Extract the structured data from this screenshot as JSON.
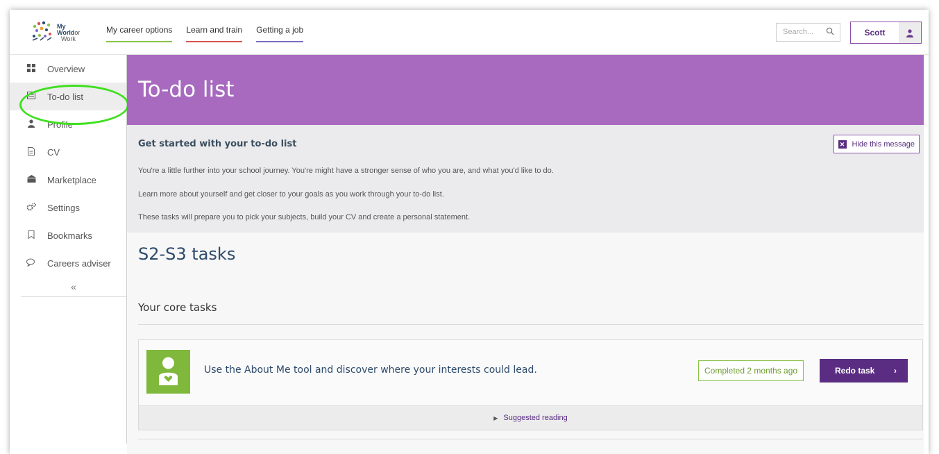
{
  "brand": {
    "logo_line1": "My",
    "logo_line2": "World",
    "logo_or": "or",
    "logo_line3": "Work"
  },
  "nav": [
    {
      "label": "My career options",
      "color": "#89c34a"
    },
    {
      "label": "Learn and train",
      "color": "#d9534f"
    },
    {
      "label": "Getting a job",
      "color": "#7b6cc0"
    }
  ],
  "search": {
    "placeholder": "Search..."
  },
  "user": {
    "name": "Scott"
  },
  "sidebar": {
    "items": [
      {
        "label": "Overview",
        "icon": "grid-icon"
      },
      {
        "label": "To-do list",
        "icon": "list-icon",
        "active": true
      },
      {
        "label": "Profile",
        "icon": "person-icon"
      },
      {
        "label": "CV",
        "icon": "document-icon"
      },
      {
        "label": "Marketplace",
        "icon": "building-icon"
      },
      {
        "label": "Settings",
        "icon": "gear-icon"
      },
      {
        "label": "Bookmarks",
        "icon": "bookmark-icon"
      },
      {
        "label": "Careers adviser",
        "icon": "chat-icon"
      }
    ],
    "collapse_label": "«"
  },
  "page": {
    "title": "To-do list",
    "notice": {
      "title": "Get started with your to-do list",
      "hide_label": "Hide this message",
      "lines": [
        "You're a little further into your school journey. You're might have a stronger sense of who you are, and what you'd like to do.",
        "Learn more about yourself and get closer to your goals as you work through your to-do list.",
        "These tasks will prepare you to pick your subjects, build your CV and create a personal statement."
      ]
    },
    "section_title": "S2-S3 tasks",
    "core_title": "Your core tasks",
    "task": {
      "text": "Use the About Me tool and discover where your interests could lead.",
      "status": "Completed 2 months ago",
      "redo_label": "Redo task",
      "reading_label": "Suggested reading"
    }
  },
  "colors": {
    "purple": "#a76abf",
    "dark_purple": "#5a2d82",
    "green": "#80b83c",
    "annotation": "#3ee01e"
  }
}
